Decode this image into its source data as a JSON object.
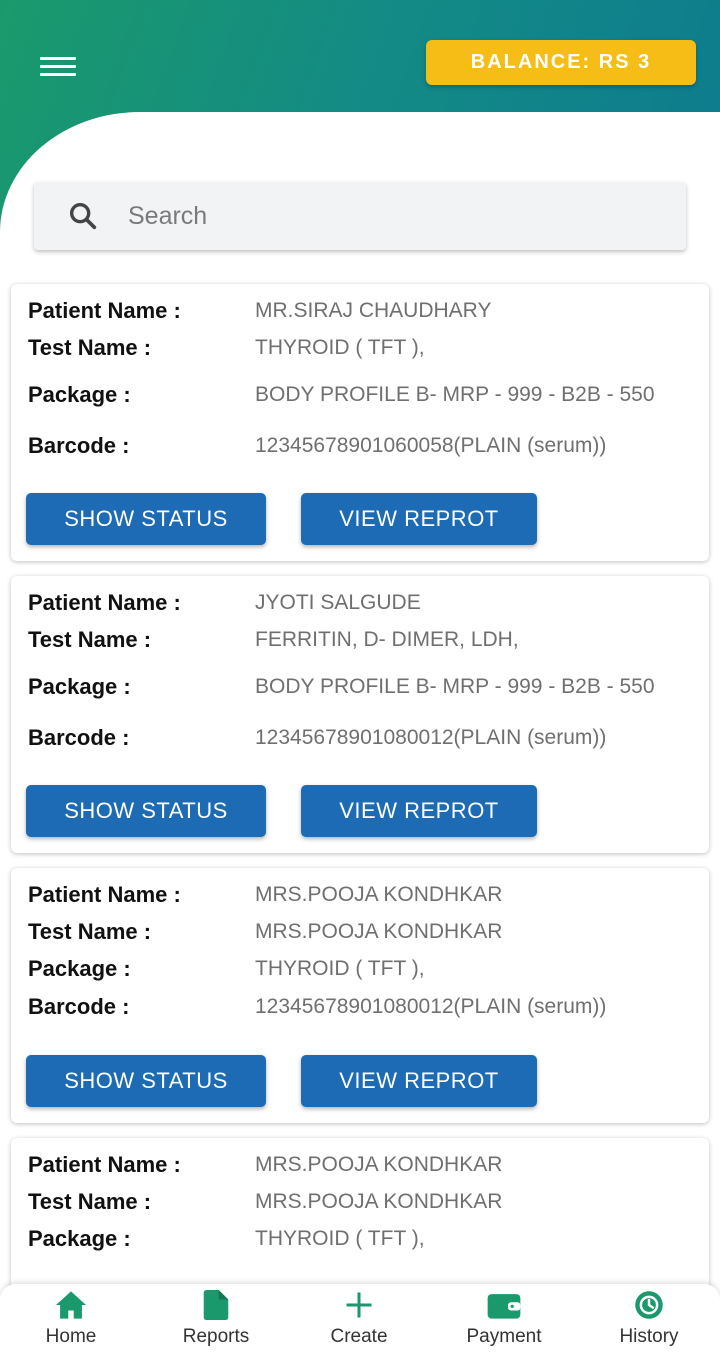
{
  "header": {
    "balance_label": "BALANCE: RS 3",
    "brand_gradient": [
      "#1a9a6c",
      "#0d7a8f"
    ]
  },
  "search": {
    "placeholder": "Search"
  },
  "labels": {
    "patient_name": "Patient Name :",
    "test_name": "Test Name :",
    "package": "Package :",
    "barcode": "Barcode :"
  },
  "buttons": {
    "show_status": "SHOW STATUS",
    "view_report": "VIEW REPROT"
  },
  "reports": [
    {
      "patient_name": "MR.SIRAJ CHAUDHARY",
      "test_name": "THYROID ( TFT ),",
      "package": "BODY PROFILE B- MRP - 999 - B2B - 550",
      "barcode": "12345678901060058(PLAIN (serum))"
    },
    {
      "patient_name": "JYOTI SALGUDE",
      "test_name": "FERRITIN, D- DIMER, LDH,",
      "package": "BODY PROFILE B- MRP - 999 - B2B - 550",
      "barcode": "12345678901080012(PLAIN (serum))"
    },
    {
      "patient_name": "MRS.POOJA KONDHKAR",
      "test_name": "MRS.POOJA KONDHKAR",
      "package": "THYROID ( TFT ),",
      "barcode": "12345678901080012(PLAIN (serum))"
    },
    {
      "patient_name": "MRS.POOJA KONDHKAR",
      "test_name": "MRS.POOJA KONDHKAR",
      "package": "THYROID ( TFT ),",
      "barcode": ""
    }
  ],
  "bottom_nav": {
    "accent_color": "#1a9a6c",
    "items": [
      {
        "label": "Home",
        "icon": "home-icon"
      },
      {
        "label": "Reports",
        "icon": "document-icon"
      },
      {
        "label": "Create",
        "icon": "plus-icon"
      },
      {
        "label": "Payment",
        "icon": "wallet-icon"
      },
      {
        "label": "History",
        "icon": "history-icon"
      }
    ]
  }
}
